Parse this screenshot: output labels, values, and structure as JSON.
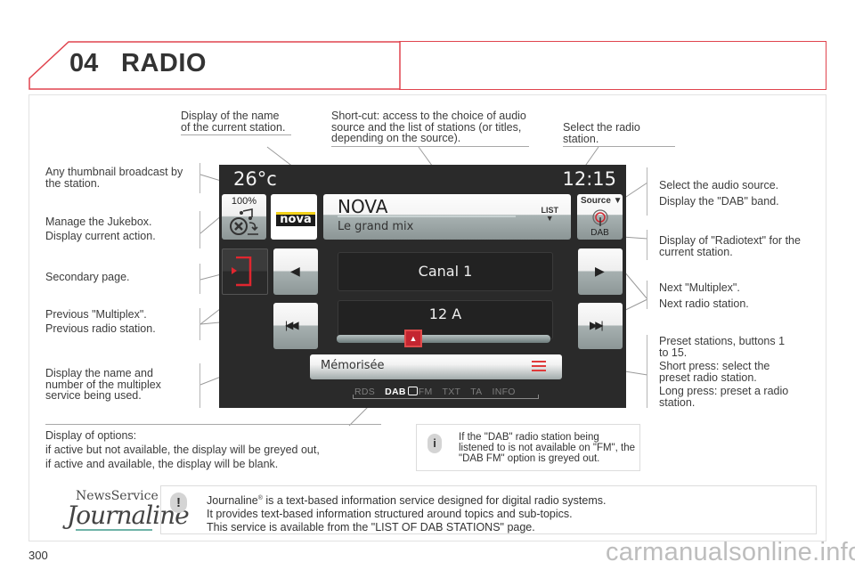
{
  "header": {
    "chapter_number": "04",
    "chapter_title": "RADIO"
  },
  "callouts": {
    "station_name": "Display of the name of the current station.",
    "shortcut": "Short-cut: access to the choice of audio source and the list of stations (or titles, depending on the source).",
    "select_station": "Select the radio station.",
    "thumbnail": "Any thumbnail broadcast by the station.",
    "jukebox_1": "Manage the Jukebox.",
    "jukebox_2": "Display current action.",
    "secondary": "Secondary page.",
    "prev_1": "Previous \"Multiplex\".",
    "prev_2": "Previous radio station.",
    "multiplex_name": "Display the name and number of the multiplex service being used.",
    "source_1": "Select the audio source.",
    "source_2": "Display the \"DAB\" band.",
    "radiotext": "Display of \"Radiotext\" for the current station.",
    "next_1": "Next \"Multiplex\".",
    "next_2": "Next radio station.",
    "preset_1": "Preset stations, buttons 1 to 15.",
    "preset_2": "Short press: select the preset radio station.",
    "preset_3": "Long press: preset a radio station.",
    "options_title": "Display of options:",
    "options_1": "if active but not available, the display will be greyed out,",
    "options_2": "if active and available, the display will be blank."
  },
  "screen": {
    "temperature": "26°c",
    "clock": "12:15",
    "jukebox_percent": "100%",
    "station_logo": "nova",
    "station_name": "NOVA",
    "radiotext": "Le grand mix",
    "list_label": "LIST",
    "source_label": "Source ▼",
    "band_label": "DAB",
    "multiplex_service": "Canal 1",
    "multiplex_number": "12 A",
    "preset_status": "Mémorisée",
    "options": {
      "rds": "RDS",
      "dab": "DAB",
      "fm": "FM",
      "txt": "TXT",
      "ta": "TA",
      "info": "INFO"
    },
    "accent_color": "#d0262f"
  },
  "notes": {
    "dab_note": "If the \"DAB\" radio station being listened to is not available on \"FM\", the \"DAB FM\" option is greyed out.",
    "journaline_1_a": "Journaline",
    "journaline_1_b": " is a text-based information service designed for digital radio systems.",
    "journaline_2": "It provides text-based information structured around topics and sub-topics.",
    "journaline_3": "This service is available from the \"LIST OF DAB STATIONS\" page."
  },
  "logo": {
    "top": "NewsService",
    "main": "Journaline"
  },
  "page_number": "300",
  "watermark": "carmanualsonline.info"
}
